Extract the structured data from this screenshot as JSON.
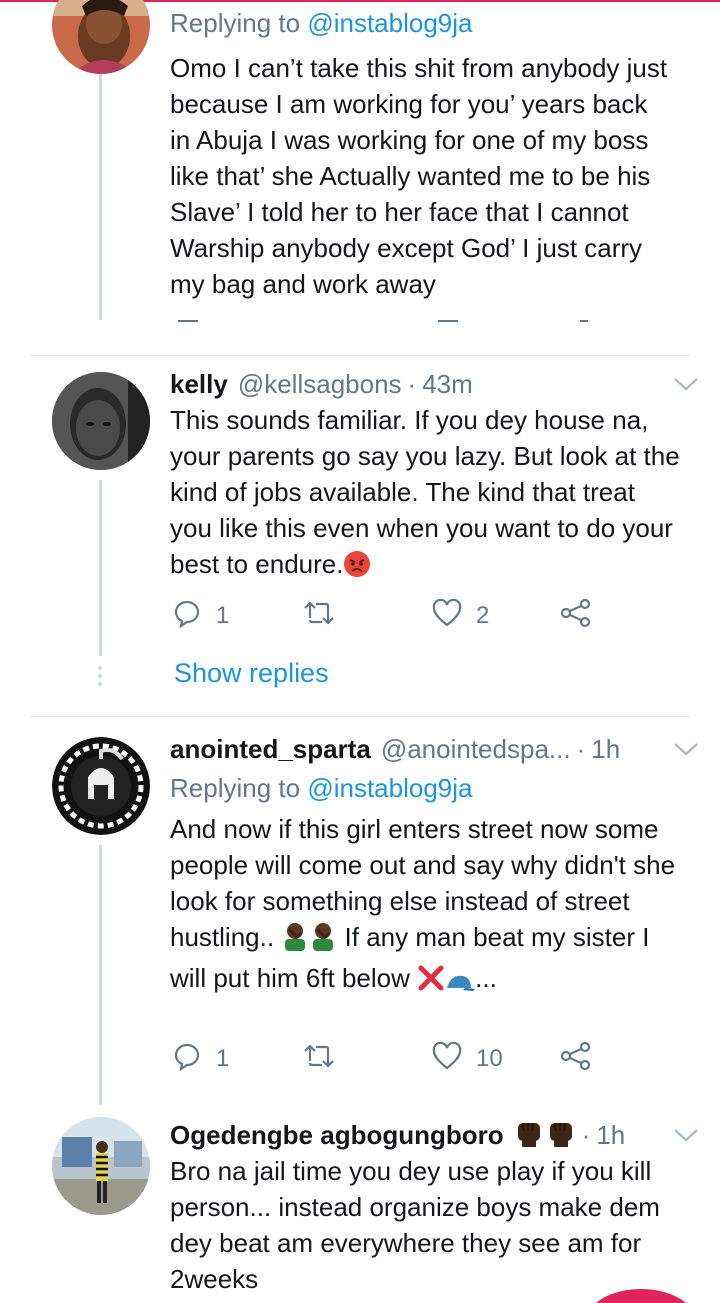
{
  "tweets": [
    {
      "reply_prefix": "Replying to ",
      "reply_mention": "@instablog9ja",
      "text": "Omo I can’t take this shit from anybody just because I am working for you’ years back in Abuja I was working for one of my boss like that’ she Actually wanted me to be his Slave’ I told her to her face that I cannot Warship anybody except God’ I just carry my bag and work away"
    },
    {
      "name": "kelly",
      "handle": "@kellsagbons",
      "separator": "·",
      "time": "43m",
      "text": "This sounds familiar. If you dey house na, your parents go say you lazy. But look at the kind of jobs available. The kind that treat you like this even when you want to do your best to endure.",
      "reply_count": "1",
      "like_count": "2",
      "show_replies": "Show replies"
    },
    {
      "name": "anointed_sparta",
      "handle": "@anointedspa...",
      "separator": "·",
      "time": "1h",
      "reply_prefix": "Replying to ",
      "reply_mention": "@instablog9ja",
      "text_a": "And now if this girl enters street now some people will come out and say why didn't she look for something else instead of street hustling..",
      "text_b": " If any man beat my sister I will put him 6ft below",
      "text_c": "...",
      "reply_count": "1",
      "like_count": "10"
    },
    {
      "name": "Ogedengbe agbogungboro",
      "separator": "·",
      "time": "1h",
      "text": "Bro na jail time you dey use play if you kill person... instead organize boys make dem dey beat am everywhere they see am for 2weeks"
    }
  ],
  "colors": {
    "link": "#1b95e0",
    "secondary": "#657786",
    "accent": "#e0245e"
  },
  "icons": [
    "reply-icon",
    "retweet-icon",
    "like-icon",
    "share-icon",
    "chevron-down-icon",
    "angry-face-icon",
    "facepalm-icon",
    "cross-mark-icon",
    "cap-icon",
    "raised-fist-icon"
  ]
}
